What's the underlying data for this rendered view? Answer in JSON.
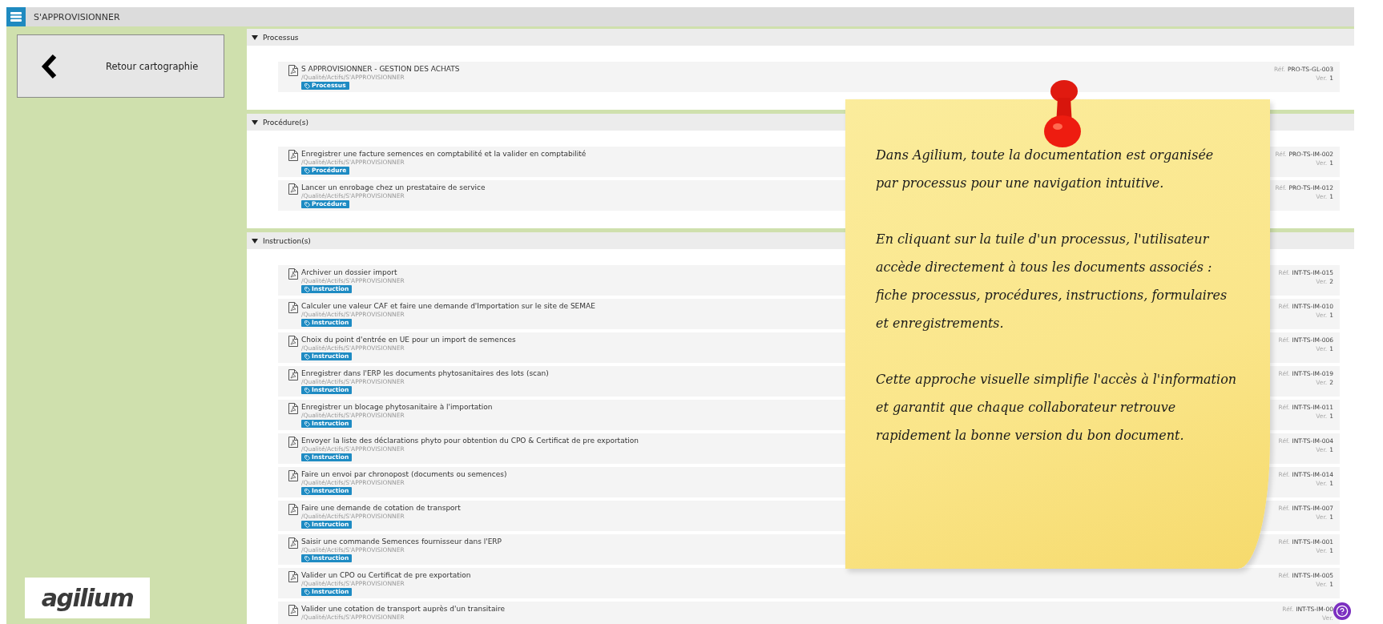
{
  "header": {
    "title": "S'APPROVISIONNER"
  },
  "back_button": {
    "label": "Retour cartographie"
  },
  "logo": {
    "text": "agilium"
  },
  "sections": [
    {
      "title": "Processus",
      "expanded": true,
      "rows": [
        {
          "title": "S APPROVISIONNER - GESTION DES ACHATS",
          "path": "/Qualité/Actifs/S'APPROVISIONNER",
          "tag": "Processus",
          "ref_label": "Réf.",
          "ref": "PRO-TS-GL-003",
          "ver_label": "Ver.",
          "ver": "1"
        }
      ]
    },
    {
      "title": "Procédure(s)",
      "expanded": true,
      "rows": [
        {
          "title": "Enregistrer une facture semences en comptabilité et la valider en comptabilité",
          "path": "/Qualité/Actifs/S'APPROVISIONNER",
          "tag": "Procédure",
          "ref_label": "Réf.",
          "ref": "PRO-TS-IM-002",
          "ver_label": "Ver.",
          "ver": "1"
        },
        {
          "title": "Lancer un enrobage chez un prestataire de service",
          "path": "/Qualité/Actifs/S'APPROVISIONNER",
          "tag": "Procédure",
          "ref_label": "Réf.",
          "ref": "PRO-TS-IM-012",
          "ver_label": "Ver.",
          "ver": "1"
        }
      ]
    },
    {
      "title": "Instruction(s)",
      "expanded": true,
      "rows": [
        {
          "title": "Archiver un dossier import",
          "path": "/Qualité/Actifs/S'APPROVISIONNER",
          "tag": "Instruction",
          "ref_label": "Réf.",
          "ref": "INT-TS-IM-015",
          "ver_label": "Ver.",
          "ver": "2"
        },
        {
          "title": "Calculer une valeur CAF et faire une demande d'Importation sur le site de SEMAE",
          "path": "/Qualité/Actifs/S'APPROVISIONNER",
          "tag": "Instruction",
          "ref_label": "Réf.",
          "ref": "INT-TS-IM-010",
          "ver_label": "Ver.",
          "ver": "1"
        },
        {
          "title": "Choix du point d'entrée en UE pour un import de semences",
          "path": "/Qualité/Actifs/S'APPROVISIONNER",
          "tag": "Instruction",
          "ref_label": "Réf.",
          "ref": "INT-TS-IM-006",
          "ver_label": "Ver.",
          "ver": "1"
        },
        {
          "title": "Enregistrer dans l'ERP les documents phytosanitaires des lots (scan)",
          "path": "/Qualité/Actifs/S'APPROVISIONNER",
          "tag": "Instruction",
          "ref_label": "Réf.",
          "ref": "INT-TS-IM-019",
          "ver_label": "Ver.",
          "ver": "2"
        },
        {
          "title": "Enregistrer un blocage phytosanitaire à l'importation",
          "path": "/Qualité/Actifs/S'APPROVISIONNER",
          "tag": "Instruction",
          "ref_label": "Réf.",
          "ref": "INT-TS-IM-011",
          "ver_label": "Ver.",
          "ver": "1"
        },
        {
          "title": "Envoyer la liste des déclarations phyto pour obtention du CPO & Certificat de pre exportation",
          "path": "/Qualité/Actifs/S'APPROVISIONNER",
          "tag": "Instruction",
          "ref_label": "Réf.",
          "ref": "INT-TS-IM-004",
          "ver_label": "Ver.",
          "ver": "1"
        },
        {
          "title": "Faire un envoi par chronopost (documents ou semences)",
          "path": "/Qualité/Actifs/S'APPROVISIONNER",
          "tag": "Instruction",
          "ref_label": "Réf.",
          "ref": "INT-TS-IM-014",
          "ver_label": "Ver.",
          "ver": "1"
        },
        {
          "title": "Faire une demande de cotation de transport",
          "path": "/Qualité/Actifs/S'APPROVISIONNER",
          "tag": "Instruction",
          "ref_label": "Réf.",
          "ref": "INT-TS-IM-007",
          "ver_label": "Ver.",
          "ver": "1"
        },
        {
          "title": "Saisir une commande Semences fournisseur dans l'ERP",
          "path": "/Qualité/Actifs/S'APPROVISIONNER",
          "tag": "Instruction",
          "ref_label": "Réf.",
          "ref": "INT-TS-IM-001",
          "ver_label": "Ver.",
          "ver": "1"
        },
        {
          "title": "Valider un CPO ou Certificat de pre exportation",
          "path": "/Qualité/Actifs/S'APPROVISIONNER",
          "tag": "Instruction",
          "ref_label": "Réf.",
          "ref": "INT-TS-IM-005",
          "ver_label": "Ver.",
          "ver": "1"
        },
        {
          "title": "Valider une cotation de transport auprès d'un transitaire",
          "path": "/Qualité/Actifs/S'APPROVISIONNER",
          "ref_label": "Réf.",
          "ref": "INT-TS-IM-00",
          "ver_label": "Ver."
        }
      ]
    }
  ],
  "note": {
    "paragraphs": [
      "Dans Agilium, toute la documentation est organisée par processus pour une navigation intuitive.",
      "En cliquant sur la tuile d'un processus, l'utilisateur accède directement à tous les documents associés : fiche processus, procédures, instructions, formulaires et enregistrements.",
      "Cette approche visuelle simplifie l'accès à l'information et garantit que chaque collaborateur retrouve rapidement la bonne version du bon document."
    ]
  }
}
